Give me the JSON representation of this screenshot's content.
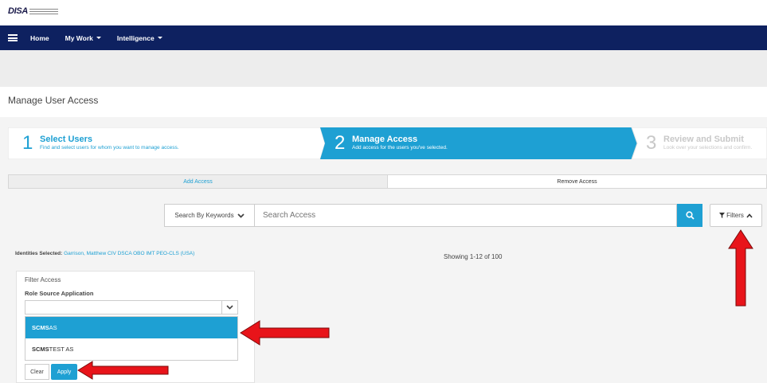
{
  "logo": {
    "text": "DISA"
  },
  "nav": {
    "items": [
      {
        "label": "Home"
      },
      {
        "label": "My Work"
      },
      {
        "label": "Intelligence"
      }
    ]
  },
  "page": {
    "title": "Manage User Access"
  },
  "wizard": {
    "steps": [
      {
        "number": "1",
        "title": "Select Users",
        "subtitle": "Find and select users for whom you want to manage access."
      },
      {
        "number": "2",
        "title": "Manage Access",
        "subtitle": "Add access for the users you've selected."
      },
      {
        "number": "3",
        "title": "Review and Submit",
        "subtitle": "Look over your selections and confirm."
      }
    ]
  },
  "tabs": [
    {
      "label": "Add Access"
    },
    {
      "label": "Remove Access"
    }
  ],
  "search": {
    "keyword_button": "Search By Keywords",
    "placeholder": "Search Access",
    "filters_label": "Filters"
  },
  "identities": {
    "label": "Identities Selected:",
    "value": "Garrison, Matthew CIV DSCA OBO IMT PEO-CLS (USA)"
  },
  "results": {
    "showing": "Showing 1-12 of 100"
  },
  "filter_panel": {
    "title": "Filter Access",
    "field_label": "Role Source Application",
    "options": [
      {
        "bold": "SCMS",
        "rest": " AS"
      },
      {
        "bold": "SCMS",
        "rest": "TEST AS"
      }
    ],
    "clear_label": "Clear",
    "apply_label": "Apply"
  },
  "colors": {
    "navbar": "#0e2160",
    "accent": "#1ea0d3",
    "annotation_arrow": "#e8141a"
  }
}
